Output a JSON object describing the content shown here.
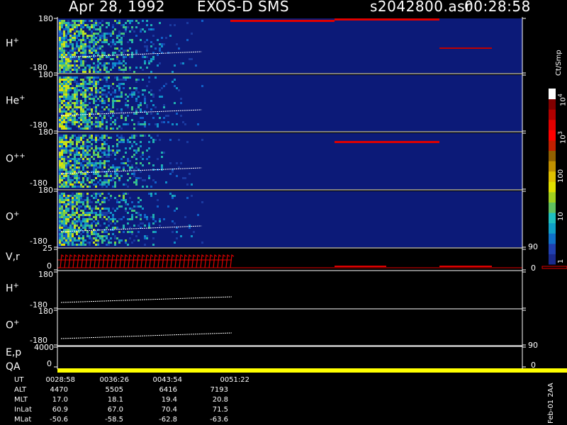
{
  "header": {
    "date": "Apr 28, 1992",
    "instrument": "EXOS-D SMS",
    "file": "s2042800.asr",
    "time": "00:28:58"
  },
  "panels": [
    {
      "label": "H",
      "sup": "+",
      "ytop": "180",
      "ybot": "-180"
    },
    {
      "label": "He",
      "sup": "+",
      "ytop": "180",
      "ybot": "-180"
    },
    {
      "label": "O",
      "sup": "++",
      "ytop": "180",
      "ybot": "-180"
    },
    {
      "label": "O",
      "sup": "+",
      "ytop": "180",
      "ybot": "-180"
    },
    {
      "label": "V,r",
      "sup": "",
      "ytop": "25",
      "ybot": "0",
      "rtop": "90",
      "rbot": "0"
    },
    {
      "label": "H",
      "sup": "+",
      "ytop": "180",
      "ybot": "-180"
    },
    {
      "label": "O",
      "sup": "+",
      "ytop": "180",
      "ybot": "-180"
    },
    {
      "label": "E,p",
      "sup": "",
      "ytop": "4000",
      "ybot": "0",
      "rtop": "90",
      "rbot": "0"
    },
    {
      "label": "QA",
      "sup": ""
    }
  ],
  "colorbar": {
    "unit": "Ct/Smp",
    "ticks": [
      "1",
      "10",
      "100",
      "10",
      "10"
    ],
    "tick_exps": [
      "",
      "",
      "",
      "3",
      "4"
    ],
    "colors": [
      "#1a2a8c",
      "#2040b0",
      "#1070c8",
      "#10a0c8",
      "#20c0c0",
      "#60c060",
      "#a0d020",
      "#e0e000",
      "#e0c000",
      "#c09000",
      "#906000",
      "#c02000",
      "#ff0000",
      "#e00000",
      "#b00000",
      "#800000",
      "#ffffff"
    ]
  },
  "footer": {
    "rows": [
      {
        "label": "UT",
        "values": [
          "0028:58",
          "0036:26",
          "0043:54",
          "0051:22"
        ]
      },
      {
        "label": "ALT",
        "values": [
          "4470",
          "5505",
          "6416",
          "7193"
        ]
      },
      {
        "label": "MLT",
        "values": [
          "17.0",
          "18.1",
          "19.4",
          "20.8"
        ]
      },
      {
        "label": "InLat",
        "values": [
          "60.9",
          "67.0",
          "70.4",
          "71.5"
        ]
      },
      {
        "label": "MLat",
        "values": [
          "-50.6",
          "-58.5",
          "-62.8",
          "-63.6"
        ]
      }
    ],
    "stamp": "Feb-01 2AA"
  },
  "chart_data": {
    "type": "heatmap",
    "time_ticks": [
      "0028:58",
      "0036:26",
      "0043:54",
      "0051:22"
    ],
    "spectrograms": [
      {
        "name": "H+",
        "ylim": [
          -180,
          180
        ],
        "data_end_frac": 0.31
      },
      {
        "name": "He+",
        "ylim": [
          -180,
          180
        ],
        "data_end_frac": 0.31
      },
      {
        "name": "O++",
        "ylim": [
          -180,
          180
        ],
        "data_end_frac": 0.31
      },
      {
        "name": "O+",
        "ylim": [
          -180,
          180
        ],
        "data_end_frac": 0.31
      }
    ],
    "line_panels": [
      {
        "name": "H+",
        "ylim": [
          -180,
          180
        ]
      },
      {
        "name": "O+",
        "ylim": [
          -180,
          180
        ]
      }
    ],
    "vr_panel": {
      "ylim": [
        0,
        25
      ],
      "right_ylim": [
        0,
        90
      ]
    },
    "ep_panel": {
      "ylim": [
        0,
        4000
      ],
      "right_ylim": [
        0,
        90
      ]
    },
    "colorbar_range": [
      1,
      10000
    ]
  }
}
